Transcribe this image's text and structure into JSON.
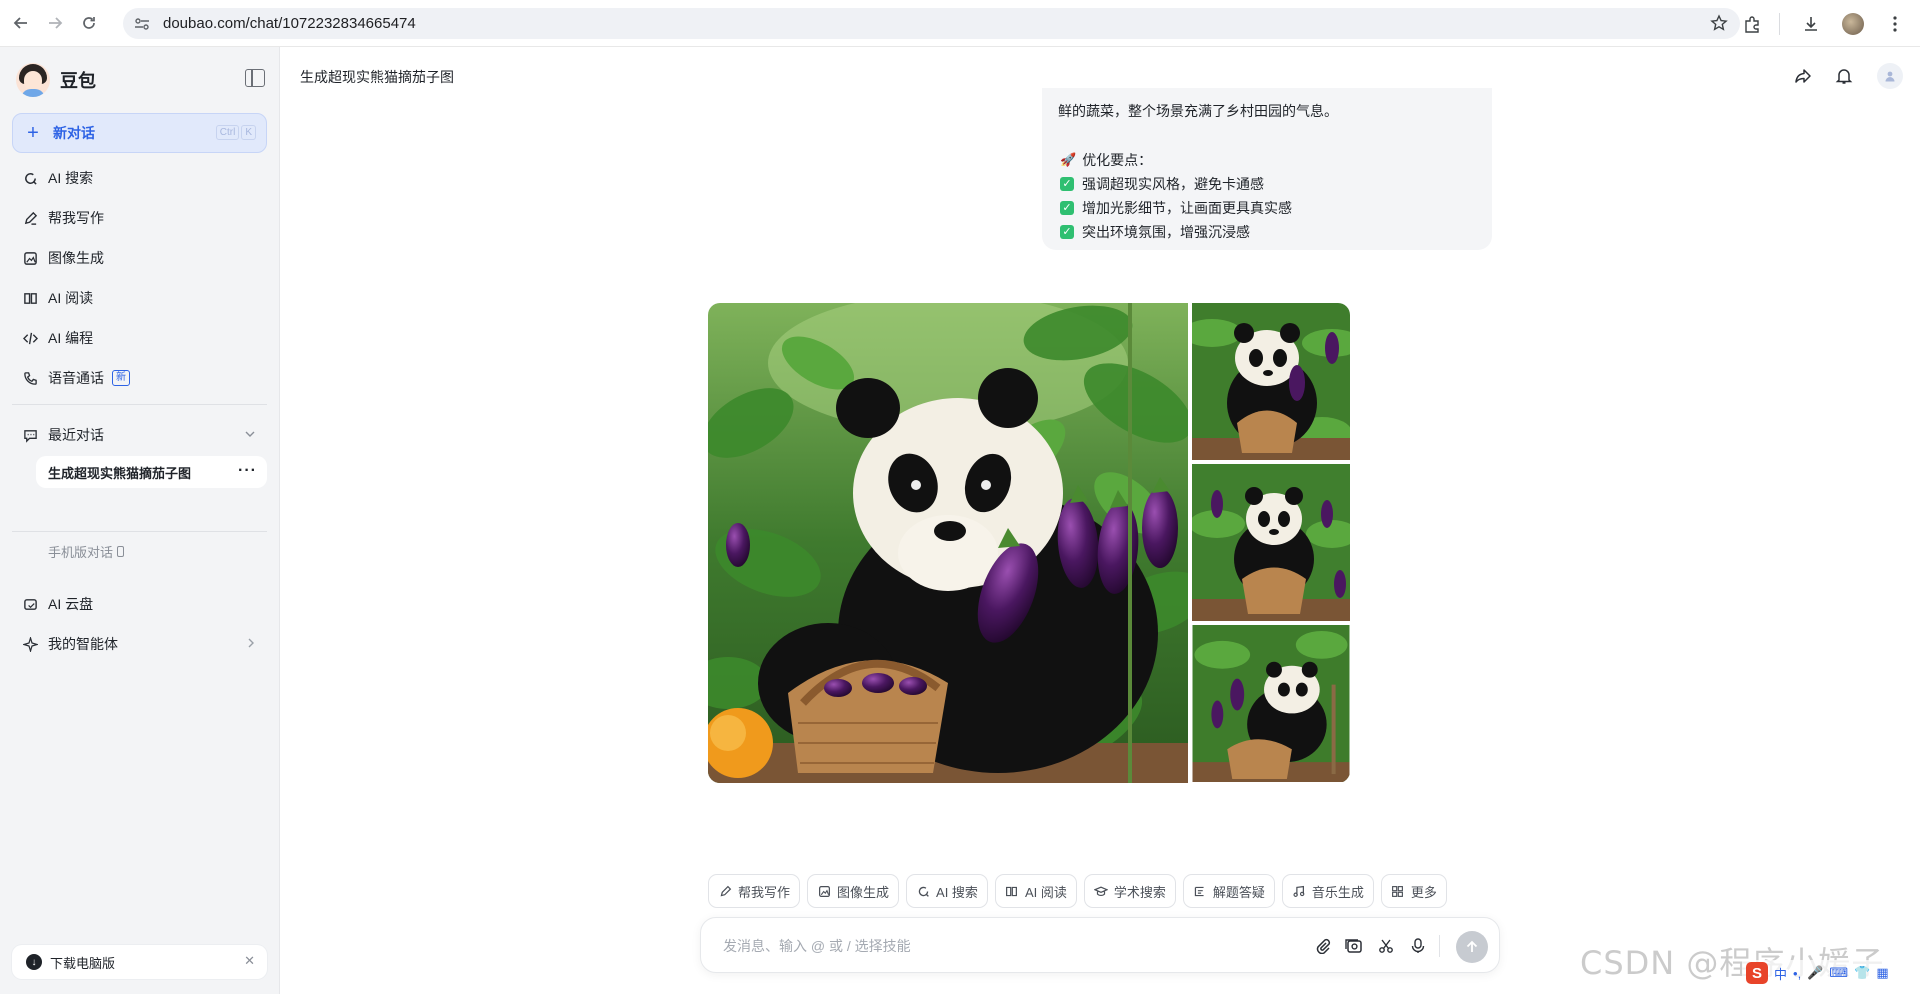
{
  "browser": {
    "url": "doubao.com/chat/1072232834665474"
  },
  "sidebar": {
    "brand_name": "豆包",
    "new_chat_label": "新对话",
    "new_chat_shortcut": [
      "Ctrl",
      "K"
    ],
    "items": [
      {
        "label": "AI 搜索",
        "icon": "search-refresh-icon"
      },
      {
        "label": "帮我写作",
        "icon": "pen-icon"
      },
      {
        "label": "图像生成",
        "icon": "image-icon"
      },
      {
        "label": "AI 阅读",
        "icon": "book-icon"
      },
      {
        "label": "AI 编程",
        "icon": "code-icon"
      },
      {
        "label": "语音通话",
        "icon": "phone-icon",
        "badge": "新"
      }
    ],
    "recent_label": "最近对话",
    "recent_chats": [
      {
        "title": "生成超现实熊猫摘茄子图"
      }
    ],
    "mobile_chats_label": "手机版对话",
    "items2": [
      {
        "label": "AI 云盘",
        "icon": "cloud-drive-icon"
      },
      {
        "label": "我的智能体",
        "icon": "sparkle-icon"
      }
    ],
    "download_label": "下载电脑版"
  },
  "header": {
    "chat_title": "生成超现实熊猫摘茄子图"
  },
  "message": {
    "text_tail": "鲜的蔬菜，整个场景充满了乡村田园的气息。",
    "optimize_heading": "优化要点：",
    "checklist": [
      "强调超现实风格，避免卡通感",
      "增加光影细节，让画面更具真实感",
      "突出环境氛围，增强沉浸感"
    ]
  },
  "skills": [
    {
      "label": "帮我写作",
      "icon": "pen-icon"
    },
    {
      "label": "图像生成",
      "icon": "image-icon"
    },
    {
      "label": "AI 搜索",
      "icon": "search-refresh-icon"
    },
    {
      "label": "AI 阅读",
      "icon": "book-icon"
    },
    {
      "label": "学术搜索",
      "icon": "graduation-cap-icon"
    },
    {
      "label": "解题答疑",
      "icon": "formula-icon"
    },
    {
      "label": "音乐生成",
      "icon": "music-note-icon"
    },
    {
      "label": "更多",
      "icon": "grid-icon"
    }
  ],
  "composer": {
    "placeholder": "发消息、输入 @ 或 / 选择技能"
  },
  "watermark": "CSDN @程序小媛子",
  "ime": {
    "logo": "S",
    "mode": "中"
  },
  "colors": {
    "accent": "#2e63e5",
    "check_green": "#2fbf71",
    "sidebar_bg": "#f3f4f6"
  }
}
